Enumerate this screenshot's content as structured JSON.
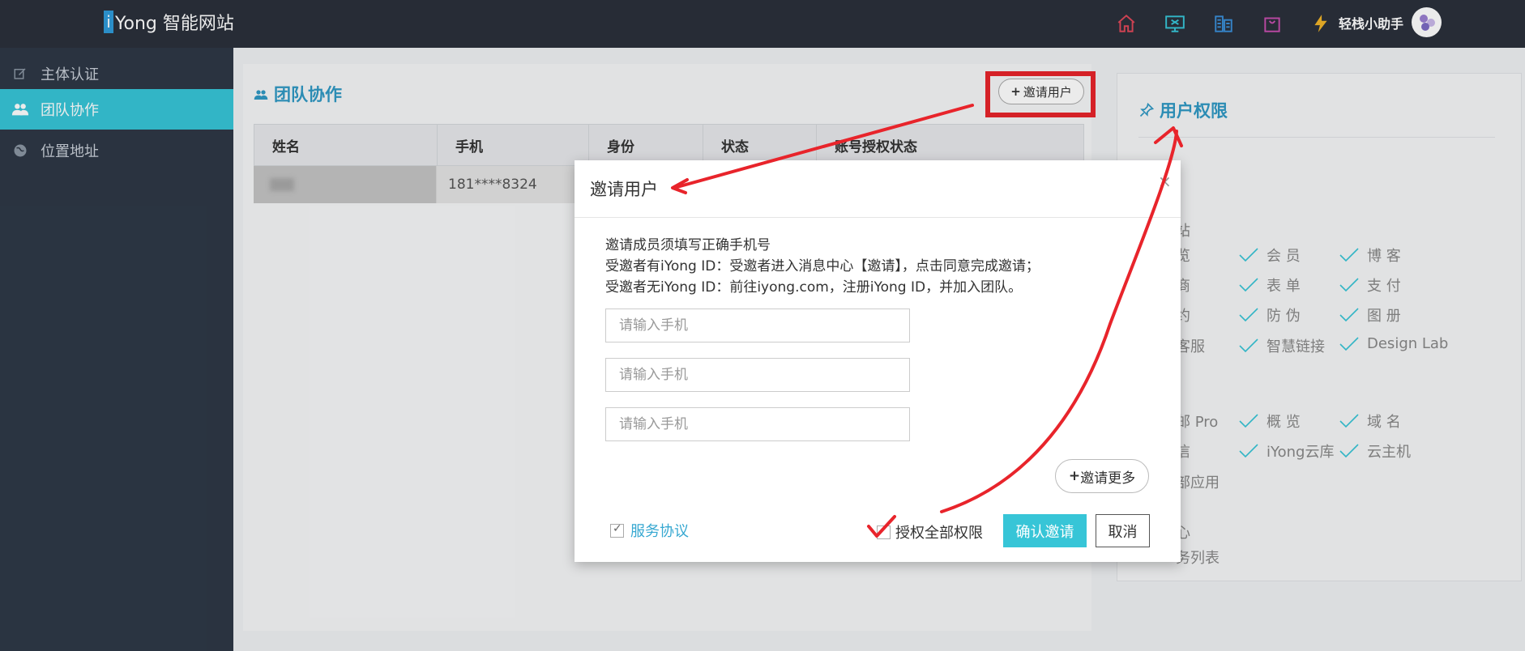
{
  "header": {
    "logo_mark": "i",
    "logo_text": "Yong 智能网站",
    "assistant": "轻栈小助手"
  },
  "top_icons": [
    {
      "name": "home-icon",
      "color": "#e0485a"
    },
    {
      "name": "monitor-icon",
      "color": "#37c5d7"
    },
    {
      "name": "building-icon",
      "color": "#3a8fd8"
    },
    {
      "name": "bag-icon",
      "color": "#c84fb0"
    },
    {
      "name": "lightning-icon",
      "color": "#f0b429"
    }
  ],
  "sidebar": {
    "items": [
      {
        "label": "主体认证",
        "icon": "edit-icon",
        "active": false
      },
      {
        "label": "团队协作",
        "icon": "users-icon",
        "active": true
      },
      {
        "label": "位置地址",
        "icon": "globe-icon",
        "active": false
      }
    ]
  },
  "team": {
    "title": "团队协作",
    "invite_label": "邀请用户",
    "columns": [
      "姓名",
      "手机",
      "身份",
      "状态",
      "账号授权状态"
    ],
    "rows": [
      {
        "name": "",
        "phone": "181****8324",
        "role": "",
        "status": "",
        "auth": ""
      }
    ]
  },
  "permissions": {
    "title": "用户权限",
    "items": [
      {
        "label": "站"
      },
      {
        "label": "览"
      },
      {
        "label": "会 员"
      },
      {
        "label": "博 客"
      },
      {
        "label": "商"
      },
      {
        "label": "表 单"
      },
      {
        "label": "支 付"
      },
      {
        "label": "约"
      },
      {
        "label": "防 伪"
      },
      {
        "label": "图 册"
      },
      {
        "label": "客服"
      },
      {
        "label": "智慧链接"
      },
      {
        "label": "Design Lab"
      },
      {
        "label": "邮 Pro"
      },
      {
        "label": "概 览"
      },
      {
        "label": "域 名"
      },
      {
        "label": "信"
      },
      {
        "label": "iYong云库"
      },
      {
        "label": "云主机"
      },
      {
        "label": "部应用"
      },
      {
        "label": "心"
      },
      {
        "label": "务列表"
      }
    ]
  },
  "modal": {
    "title": "邀请用户",
    "close": "×",
    "info_lines": [
      "邀请成员须填写正确手机号",
      "受邀者有iYong ID：受邀者进入消息中心【邀请】，点击同意完成邀请；",
      "受邀者无iYong ID：前往iyong.com，注册iYong ID，并加入团队。"
    ],
    "phone_placeholder": "请输入手机",
    "more_label": "邀请更多",
    "agree_label": "服务协议",
    "grant_label": "授权全部权限",
    "confirm_label": "确认邀请",
    "cancel_label": "取消"
  },
  "colors": {
    "accent": "#37c5d7",
    "title_blue": "#2f98c4",
    "annotation_red": "#e8242b"
  }
}
